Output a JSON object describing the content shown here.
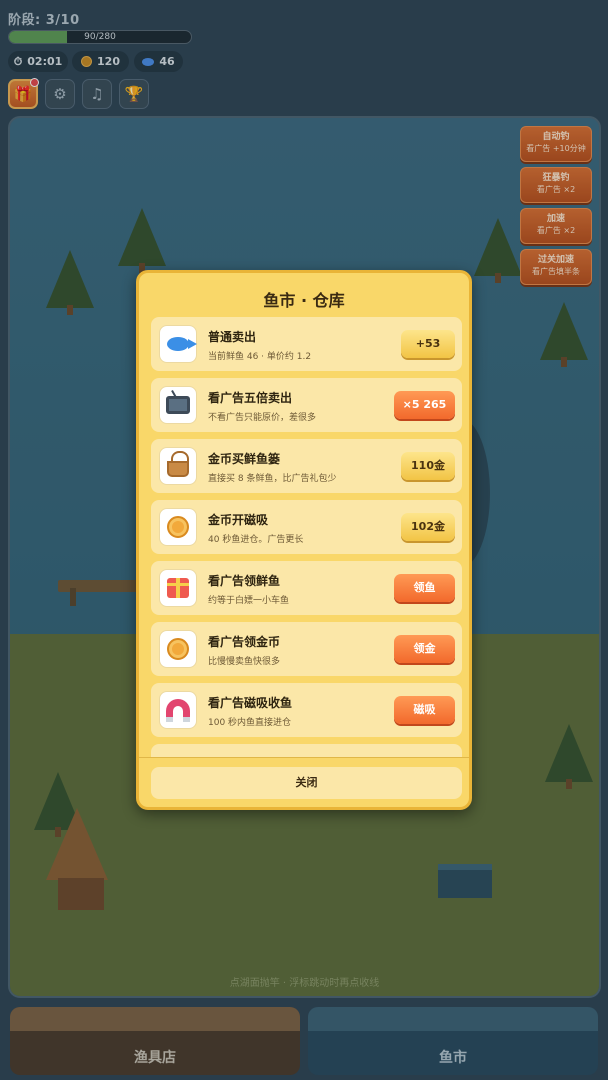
{
  "hud": {
    "stage_label": "阶段: 3/10",
    "progress_text": "90/280",
    "progress_fraction": 0.32,
    "timer": "02:01",
    "coins": "120",
    "fish": "46",
    "icons": [
      "gift-icon",
      "gear-icon",
      "music-icon",
      "trophy-icon"
    ]
  },
  "side_buttons": [
    {
      "title": "自动钓",
      "sub": "看广告 +10分钟"
    },
    {
      "title": "狂暴钓",
      "sub": "看广告 ×2"
    },
    {
      "title": "加速",
      "sub": "看广告 ×2"
    },
    {
      "title": "过关加速",
      "sub": "看广告填半条"
    }
  ],
  "scene": {
    "hint": "点湖面抛竿 · 浮标跳动时再点收线"
  },
  "tabs": {
    "shop": "渔具店",
    "market": "鱼市"
  },
  "modal": {
    "title": "鱼市 · 仓库",
    "close_label": "关闭",
    "rows": [
      {
        "icon": "fish-icon",
        "name": "普通卖出",
        "desc": "当前鲜鱼 46 · 单价约 1.2",
        "button": "+53",
        "style": "gold"
      },
      {
        "icon": "tv-icon",
        "name": "看广告五倍卖出",
        "desc": "不看广告只能原价，差很多",
        "button": "×5 265",
        "style": "orange"
      },
      {
        "icon": "basket-icon",
        "name": "金币买鲜鱼篓",
        "desc": "直接买 8 条鲜鱼，比广告礼包少",
        "button": "110金",
        "style": "gold"
      },
      {
        "icon": "coin-icon",
        "name": "金币开磁吸",
        "desc": "40 秒鱼进仓。广告更长",
        "button": "102金",
        "style": "gold"
      },
      {
        "icon": "gift-icon",
        "name": "看广告领鲜鱼",
        "desc": "约等于白嫖一小车鱼",
        "button": "领鱼",
        "style": "orange"
      },
      {
        "icon": "coin-icon",
        "name": "看广告领金币",
        "desc": "比慢慢卖鱼快很多",
        "button": "领金",
        "style": "orange"
      },
      {
        "icon": "magnet-icon",
        "name": "看广告磁吸收鱼",
        "desc": "100 秒内鱼直接进仓",
        "button": "磁吸",
        "style": "orange"
      }
    ]
  }
}
